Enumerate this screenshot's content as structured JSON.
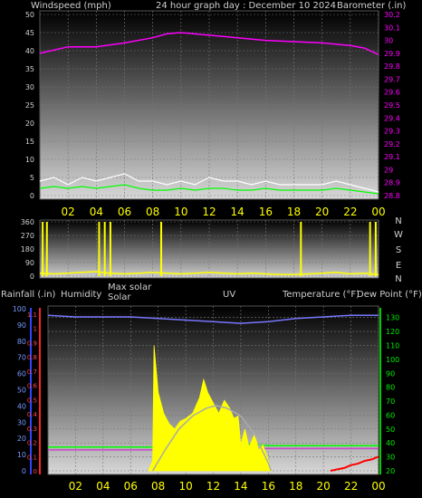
{
  "chart_data": [
    {
      "type": "line",
      "title": "24 hour graph day : December 10 2024",
      "left_axis_label": "Windspeed (mph)",
      "right_axis_label": "Barometer (.in)",
      "x_ticks": [
        "02",
        "04",
        "06",
        "08",
        "10",
        "12",
        "14",
        "16",
        "18",
        "20",
        "22",
        "00"
      ],
      "left_ylim": [
        0,
        50
      ],
      "left_ticks": [
        0,
        5,
        10,
        15,
        20,
        25,
        30,
        35,
        40,
        45,
        50
      ],
      "right_ylim": [
        28.8,
        30.2
      ],
      "right_ticks": [
        "28.8",
        "28.9",
        "29",
        "29.1",
        "29.2",
        "29.3",
        "29.4",
        "29.5",
        "29.6",
        "29.7",
        "29.8",
        "29.9",
        "30",
        "30.1",
        "30.2"
      ],
      "grid": true,
      "series": [
        {
          "color": "#ff00ff",
          "axis": "right",
          "x": [
            0,
            2,
            4,
            6,
            8,
            9,
            10,
            12,
            14,
            16,
            18,
            20,
            22,
            23,
            24
          ],
          "y": [
            29.9,
            29.95,
            29.95,
            29.98,
            30.02,
            30.05,
            30.06,
            30.04,
            30.02,
            30.0,
            29.99,
            29.98,
            29.96,
            29.94,
            29.89
          ]
        },
        {
          "color": "#ffffff",
          "axis": "left",
          "x": [
            0,
            1,
            2,
            3,
            4,
            5,
            6,
            7,
            8,
            9,
            10,
            11,
            12,
            13,
            14,
            15,
            16,
            17,
            18,
            19,
            20,
            21,
            22,
            23,
            24
          ],
          "y": [
            4,
            5,
            3,
            5,
            4,
            5,
            6,
            4,
            4,
            3,
            4,
            3,
            5,
            4,
            4,
            3,
            4,
            3,
            3,
            3,
            3,
            4,
            3,
            2,
            1
          ]
        },
        {
          "color": "#00ff00",
          "axis": "left",
          "x": [
            0,
            1,
            2,
            3,
            4,
            5,
            6,
            7,
            8,
            9,
            10,
            11,
            12,
            13,
            14,
            15,
            16,
            17,
            18,
            19,
            20,
            21,
            22,
            23,
            24
          ],
          "y": [
            2,
            2.5,
            2,
            2.5,
            2,
            2.5,
            3,
            2,
            1.5,
            1.5,
            2,
            1.5,
            2,
            2,
            1.5,
            1.5,
            2,
            1.5,
            1.5,
            1.5,
            1.5,
            2,
            1.5,
            1,
            0.5
          ]
        }
      ]
    },
    {
      "type": "line",
      "y_ticks": [
        0,
        90,
        180,
        270,
        360
      ],
      "ylim": [
        0,
        360
      ],
      "direction_labels": [
        "N",
        "W",
        "S",
        "E",
        "N"
      ],
      "series": [
        {
          "color": "#ffff00",
          "mode": "direction",
          "x": [
            0,
            1,
            2,
            3,
            4,
            5,
            6,
            7,
            8,
            9,
            10,
            11,
            12,
            13,
            14,
            15,
            16,
            17,
            18,
            19,
            20,
            21,
            22,
            23,
            24
          ],
          "y": [
            20,
            15,
            20,
            25,
            30,
            20,
            15,
            20,
            25,
            20,
            15,
            20,
            25,
            20,
            15,
            20,
            15,
            10,
            10,
            15,
            20,
            25,
            15,
            20,
            10
          ]
        }
      ],
      "spikes": [
        {
          "x": 0.2,
          "y": 360
        },
        {
          "x": 0.5,
          "y": 360
        },
        {
          "x": 4.2,
          "y": 360
        },
        {
          "x": 4.6,
          "y": 360
        },
        {
          "x": 5.0,
          "y": 360
        },
        {
          "x": 8.6,
          "y": 360
        },
        {
          "x": 18.5,
          "y": 360
        },
        {
          "x": 23.4,
          "y": 360
        },
        {
          "x": 23.8,
          "y": 360
        }
      ]
    },
    {
      "type": "area",
      "labels": {
        "rainfall": "Rainfall (.in)",
        "humidity": "Humidity",
        "max_solar": "Max solar",
        "solar": "Solar",
        "uv": "UV",
        "temperature": "Temperature (°F)",
        "dew_point": "Dew Point (°F)"
      },
      "x_ticks": [
        "02",
        "04",
        "06",
        "08",
        "10",
        "12",
        "14",
        "16",
        "18",
        "20",
        "22",
        "00"
      ],
      "humidity_ticks": [
        0,
        10,
        20,
        30,
        40,
        50,
        60,
        70,
        80,
        90,
        100
      ],
      "humidity_ylim": [
        0,
        100
      ],
      "rain_ticks": [
        "0",
        "0.1",
        "0.2",
        "0.3",
        "0.4",
        "0.5",
        "0.6",
        "0.7",
        "0.8",
        "0.9",
        "1",
        "1.1"
      ],
      "temp_ticks": [
        20,
        30,
        40,
        50,
        60,
        70,
        80,
        90,
        100,
        110,
        120,
        130
      ],
      "temp_ylim": [
        20,
        135
      ],
      "series": [
        {
          "name": "Humidity",
          "color": "#7777ff",
          "x": [
            0,
            2,
            4,
            6,
            8,
            10,
            12,
            14,
            16,
            18,
            20,
            22,
            24
          ],
          "y": [
            96,
            95,
            95,
            95,
            94,
            93,
            92,
            91,
            92,
            94,
            95,
            96,
            96
          ]
        },
        {
          "name": "Temperature",
          "color": "#00ff00",
          "x": [
            0,
            2,
            4,
            6,
            8,
            9,
            10,
            11,
            12,
            13,
            14,
            15,
            16,
            18,
            20,
            22,
            24
          ],
          "y": [
            37,
            37,
            37,
            37,
            37,
            38,
            38,
            39,
            40,
            40,
            39,
            39,
            38,
            38,
            38,
            38,
            38
          ]
        },
        {
          "name": "Dew Point",
          "color": "#cc44cc",
          "x": [
            0,
            2,
            4,
            6,
            8,
            10,
            12,
            14,
            16,
            18,
            20,
            22,
            24
          ],
          "y": [
            35,
            35,
            35,
            35,
            35,
            36,
            36,
            36,
            36,
            36,
            36,
            36,
            36
          ]
        },
        {
          "name": "Solar",
          "color": "#ffff00",
          "x": [
            7.3,
            7.6,
            7.7,
            8.0,
            8.4,
            8.8,
            9.2,
            9.6,
            10,
            10.5,
            11,
            11.3,
            11.6,
            12,
            12.4,
            12.8,
            13.2,
            13.5,
            13.8,
            14,
            14.3,
            14.6,
            15,
            15.3,
            15.6,
            16,
            16.2
          ],
          "y": [
            0,
            4,
            48,
            30,
            22,
            18,
            16,
            19,
            20,
            22,
            28,
            35,
            30,
            26,
            22,
            27,
            24,
            20,
            21,
            10,
            16,
            9,
            14,
            8,
            10,
            4,
            0
          ]
        },
        {
          "name": "Max solar",
          "color": "#aaaaaa",
          "x": [
            7.6,
            8.5,
            9.5,
            10.5,
            11.5,
            12.2,
            13,
            14,
            15,
            16,
            16.2
          ],
          "y": [
            0,
            8,
            16,
            21,
            24,
            25,
            24,
            21,
            14,
            3,
            0
          ]
        },
        {
          "name": "Rainfall",
          "color": "#ff0000",
          "x": [
            20.5,
            21,
            21.5,
            22,
            22.5,
            23,
            23.5,
            24
          ],
          "y": [
            0,
            0.01,
            0.02,
            0.04,
            0.05,
            0.07,
            0.08,
            0.1
          ]
        }
      ]
    }
  ]
}
